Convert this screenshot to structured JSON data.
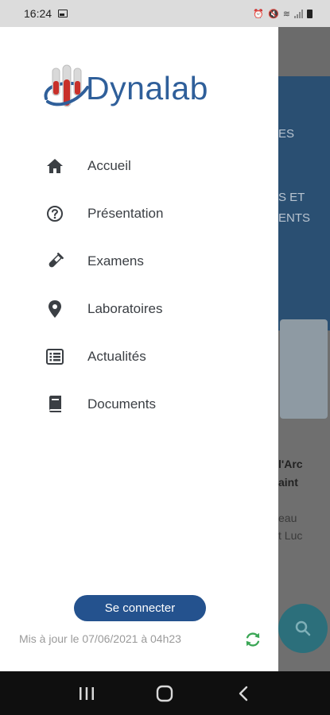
{
  "status_bar": {
    "time": "16:24",
    "icons": [
      "gallery-icon",
      "alarm-icon",
      "mute-icon",
      "wifi-icon",
      "signal-icon",
      "battery-icon"
    ]
  },
  "drawer": {
    "logo_text": "Dynalab",
    "menu": [
      {
        "label": "Accueil",
        "icon": "home-icon"
      },
      {
        "label": "Présentation",
        "icon": "question-circle-icon"
      },
      {
        "label": "Examens",
        "icon": "test-tube-icon"
      },
      {
        "label": "Laboratoires",
        "icon": "map-pin-icon"
      },
      {
        "label": "Actualités",
        "icon": "news-list-icon"
      },
      {
        "label": "Documents",
        "icon": "book-icon"
      }
    ],
    "connect_label": "Se connecter",
    "update_text": "Mis à jour le 07/06/2021 à 04h23"
  },
  "background": {
    "banner_lines": [
      "ES",
      "S ET",
      "ENTS"
    ],
    "card_title_lines": [
      "l'Arc",
      "aint"
    ],
    "card_sub_lines": [
      "eau",
      "t Luc"
    ]
  },
  "colors": {
    "brand_blue": "#24528e",
    "logo_blue": "#2f5f9a",
    "logo_red": "#c8302a",
    "refresh_green": "#3aa655"
  },
  "nav_bar": {
    "buttons": [
      "recent-apps-icon",
      "home-button-icon",
      "back-icon"
    ]
  }
}
